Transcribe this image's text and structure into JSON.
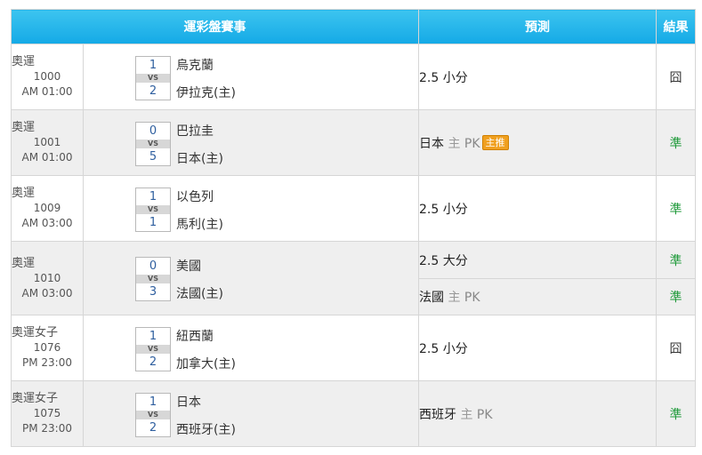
{
  "header": {
    "event": "運彩盤賽事",
    "prediction": "預測",
    "result": "結果"
  },
  "matches": [
    {
      "league": "奧運",
      "number": "1000",
      "time": "AM 01:00",
      "score_home": "1",
      "score_away": "2",
      "vs": "VS",
      "team1": "烏克蘭",
      "team2": "伊拉克(主)",
      "predictions": [
        {
          "text": "2.5 小分",
          "result": "囧"
        }
      ]
    },
    {
      "league": "奧運",
      "number": "1001",
      "time": "AM 01:00",
      "score_home": "0",
      "score_away": "5",
      "vs": "VS",
      "team1": "巴拉圭",
      "team2": "日本(主)",
      "predictions": [
        {
          "team": "日本",
          "host": "主",
          "pk": "PK",
          "badge": "主推",
          "result": "準"
        }
      ]
    },
    {
      "league": "奧運",
      "number": "1009",
      "time": "AM 03:00",
      "score_home": "1",
      "score_away": "1",
      "vs": "VS",
      "team1": "以色列",
      "team2": "馬利(主)",
      "predictions": [
        {
          "text": "2.5 小分",
          "result": "準"
        }
      ]
    },
    {
      "league": "奧運",
      "number": "1010",
      "time": "AM 03:00",
      "score_home": "0",
      "score_away": "3",
      "vs": "VS",
      "team1": "美國",
      "team2": "法國(主)",
      "predictions": [
        {
          "text": "2.5 大分",
          "result": "準"
        },
        {
          "team": "法國",
          "host": "主",
          "pk": "PK",
          "result": "準"
        }
      ]
    },
    {
      "league": "奧運女子",
      "number": "1076",
      "time": "PM 23:00",
      "score_home": "1",
      "score_away": "2",
      "vs": "VS",
      "team1": "紐西蘭",
      "team2": "加拿大(主)",
      "predictions": [
        {
          "text": "2.5 小分",
          "result": "囧"
        }
      ]
    },
    {
      "league": "奧運女子",
      "number": "1075",
      "time": "PM 23:00",
      "score_home": "1",
      "score_away": "2",
      "vs": "VS",
      "team1": "日本",
      "team2": "西班牙(主)",
      "predictions": [
        {
          "team": "西班牙",
          "host": "主",
          "pk": "PK",
          "result": "準"
        }
      ]
    }
  ],
  "colors": {
    "header_bg": "#14a9e6",
    "result_ok": "#1f9a3a",
    "badge_bg": "#f0a020",
    "alt_row_bg": "#efefef"
  }
}
